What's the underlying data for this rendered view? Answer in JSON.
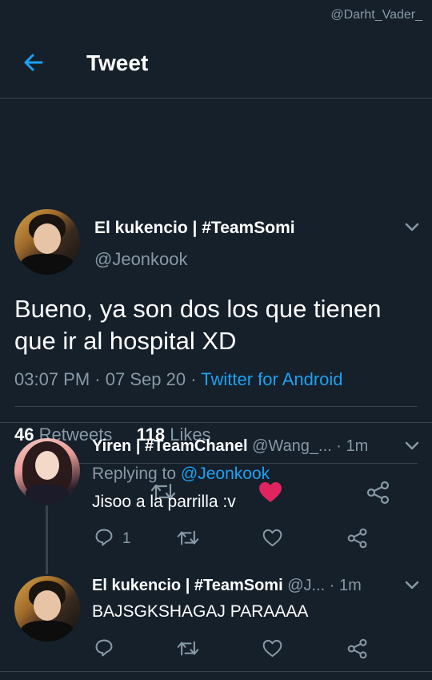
{
  "watermark": "@Darht_Vader_",
  "header": {
    "title": "Tweet"
  },
  "tweet": {
    "name": "El kukencio | #TeamSomi",
    "handle": "@Jeonkook",
    "text": "Bueno, ya son dos los que tienen que ir al hospital XD",
    "time": "03:07 PM",
    "date": "07 Sep 20",
    "source": "Twitter for Android",
    "retweets_count": "46",
    "retweets_label": "Retweets",
    "likes_count": "118",
    "likes_label": "Likes",
    "liked_color": "#e0245e"
  },
  "replies": [
    {
      "name": "Yiren | #TeamChanel",
      "handle": "@Wang_...",
      "time": "1m",
      "replying_prefix": "Replying to",
      "replying_to": "@Jeonkook",
      "text": "Jisoo a la parrilla :v",
      "reply_count": "1"
    },
    {
      "name": "El kukencio | #TeamSomi",
      "handle": "@J...",
      "time": "1m",
      "text": "BAJSGKSHAGAJ PARAAAA"
    }
  ],
  "colors": {
    "background": "#15202b",
    "accent": "#1da1f2",
    "muted": "#8899a6",
    "divider": "#38444d"
  }
}
